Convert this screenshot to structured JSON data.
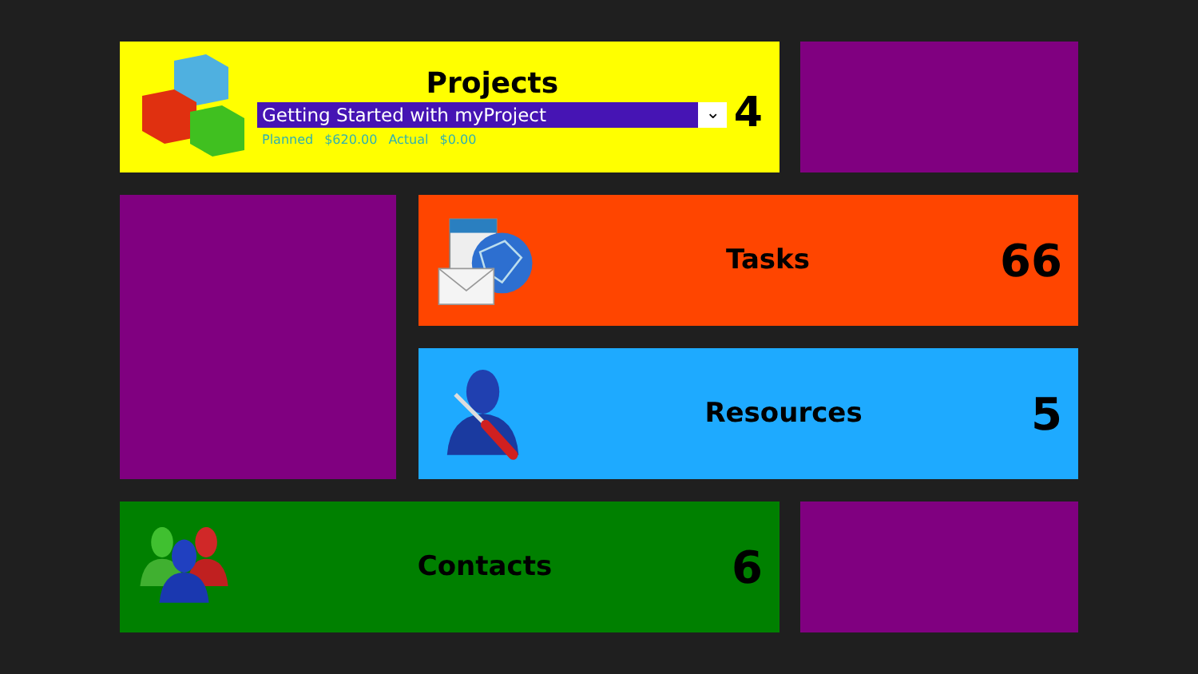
{
  "tiles": [
    {
      "kind": "projects",
      "color": "#ffff00",
      "title": "Projects",
      "project": "Getting Started with myProject",
      "dropdown_icon": "⌄",
      "planned_label": "Planned",
      "planned": "$620.00",
      "actual_label": "Actual",
      "actual": "$0.00",
      "count": "4"
    },
    {
      "kind": "blank",
      "color": "#800080"
    },
    {
      "kind": "blank",
      "color": "#800080"
    },
    {
      "kind": "tasks",
      "color": "#ff4500",
      "title": "Tasks",
      "count": "66"
    },
    {
      "kind": "resources",
      "color": "#1eaaff",
      "title": "Resources",
      "count": "5"
    },
    {
      "kind": "contacts",
      "color": "#008000",
      "title": "Contacts",
      "count": "6"
    },
    {
      "kind": "blank",
      "color": "#800080"
    }
  ]
}
